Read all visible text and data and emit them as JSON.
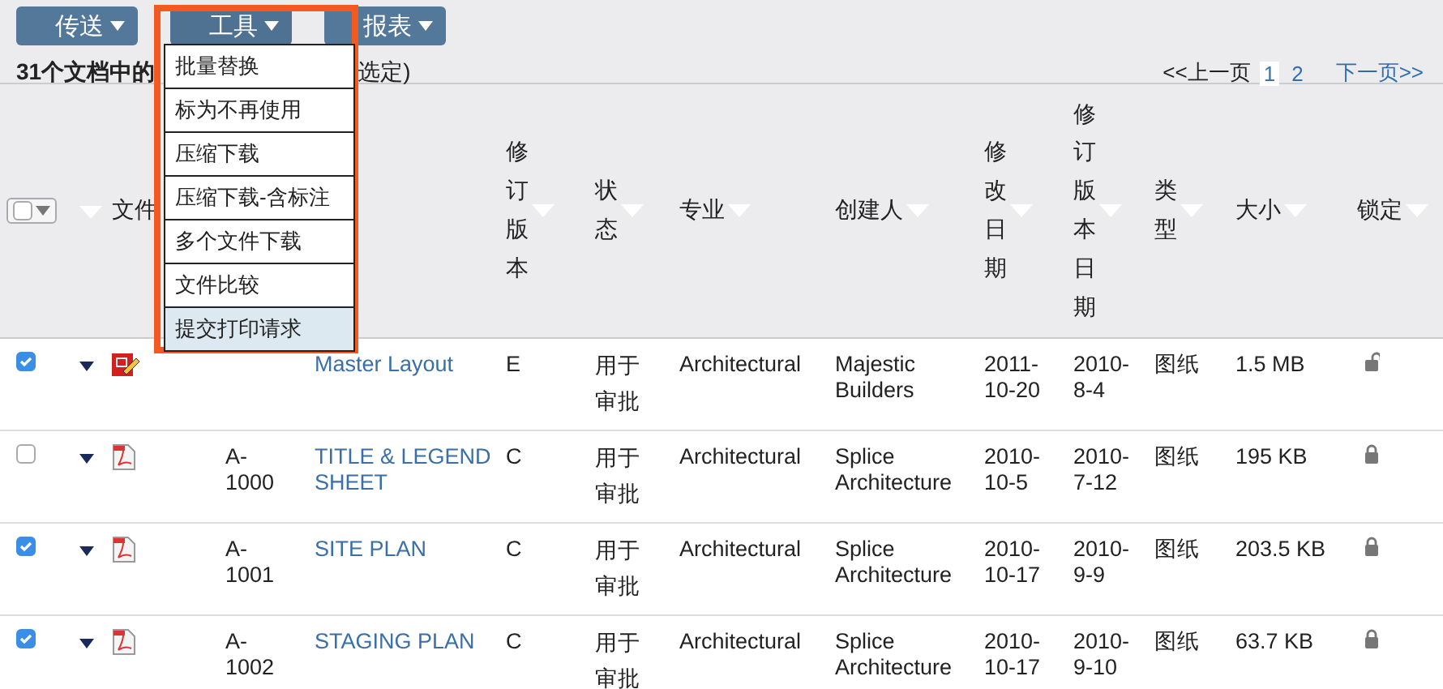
{
  "toolbar": {
    "buttons": [
      {
        "label": "传送"
      },
      {
        "label": "工具",
        "open": true
      },
      {
        "label": "报表"
      }
    ]
  },
  "menu": {
    "items": [
      {
        "label": "批量替换",
        "selected": false
      },
      {
        "label": "标为不再使用",
        "selected": false
      },
      {
        "label": "压缩下载",
        "selected": false
      },
      {
        "label": "压缩下载-含标注",
        "selected": false
      },
      {
        "label": "多个文件下载",
        "selected": false
      },
      {
        "label": "文件比较",
        "selected": false
      },
      {
        "label": "提交打印请求",
        "selected": true
      }
    ]
  },
  "summary": {
    "text_start": "31个文档中的",
    "text_end": "选定)"
  },
  "pagination": {
    "prev": "<<上一页",
    "pages": [
      {
        "label": "1",
        "selected": true
      },
      {
        "label": "2",
        "selected": false
      }
    ],
    "next": "下一页>>"
  },
  "table": {
    "columns": [
      "文件",
      "修订版本",
      "状态",
      "专业",
      "创建人",
      "修改日期",
      "修订版本日期",
      "类型",
      "大小",
      "锁定"
    ],
    "rows": [
      {
        "checked": true,
        "kind": "drawing",
        "name": "Master Layout",
        "revision": "E",
        "status": "用于审批",
        "discipline": "Architectural",
        "creator": "Majestic Builders",
        "modified": "2011-10-20",
        "revision_date": "2010-8-4",
        "type": "图纸",
        "size": "1.5 MB",
        "locked": false
      },
      {
        "checked": false,
        "kind": "pdf",
        "number": "A-1000",
        "name": "TITLE & LEGEND SHEET",
        "revision": "C",
        "status": "用于审批",
        "discipline": "Architectural",
        "creator": "Splice Architecture",
        "modified": "2010-10-5",
        "revision_date": "2010-7-12",
        "type": "图纸",
        "size": "195 KB",
        "locked": true
      },
      {
        "checked": true,
        "kind": "pdf",
        "number": "A-1001",
        "name": "SITE PLAN",
        "revision": "C",
        "status": "用于审批",
        "discipline": "Architectural",
        "creator": "Splice Architecture",
        "modified": "2010-10-17",
        "revision_date": "2010-9-9",
        "type": "图纸",
        "size": "203.5 KB",
        "locked": true
      },
      {
        "checked": true,
        "kind": "pdf",
        "number": "A-1002",
        "name": "STAGING PLAN",
        "revision": "C",
        "status": "用于审批",
        "discipline": "Architectural",
        "creator": "Splice Architecture",
        "modified": "2010-10-17",
        "revision_date": "2010-9-10",
        "type": "图纸",
        "size": "63.7 KB",
        "locked": true
      }
    ]
  }
}
